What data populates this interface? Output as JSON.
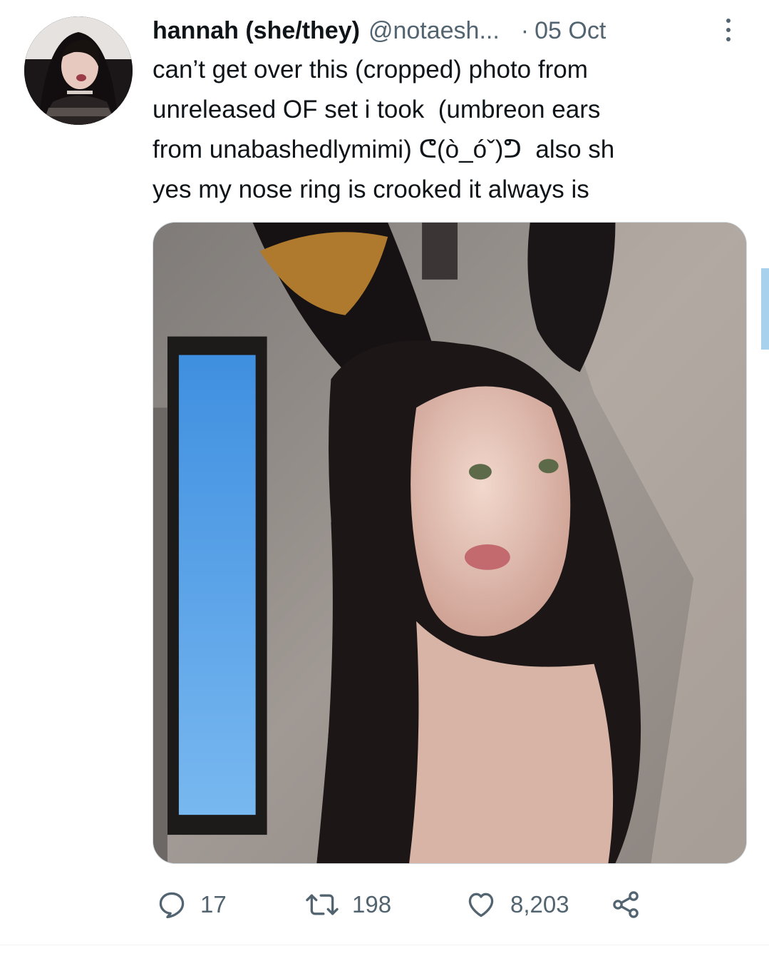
{
  "tweet": {
    "display_name": "hannah (she/they)",
    "handle": "@notaesh...",
    "separator": "·",
    "time": "05 Oct",
    "text": "can’t get over this (cropped) photo from\nunreleased OF set i took  (umbreon ears\nfrom unabashedlymimi) ᕦ(ò_óˇ)ᕤ  also sh\nyes my nose ring is crooked it always is"
  },
  "actions": {
    "reply_count": "17",
    "retweet_count": "198",
    "like_count": "8,203"
  },
  "icons": {
    "avatar": "profile-photo",
    "more": "more-vertical-icon",
    "reply": "reply-bubble-icon",
    "retweet": "retweet-arrows-icon",
    "like": "heart-icon",
    "share": "share-nodes-icon"
  },
  "colors": {
    "text_primary": "#0f1419",
    "text_secondary": "#536471",
    "divider": "#eff3f4",
    "scrollbar": "#a8d1ee"
  }
}
